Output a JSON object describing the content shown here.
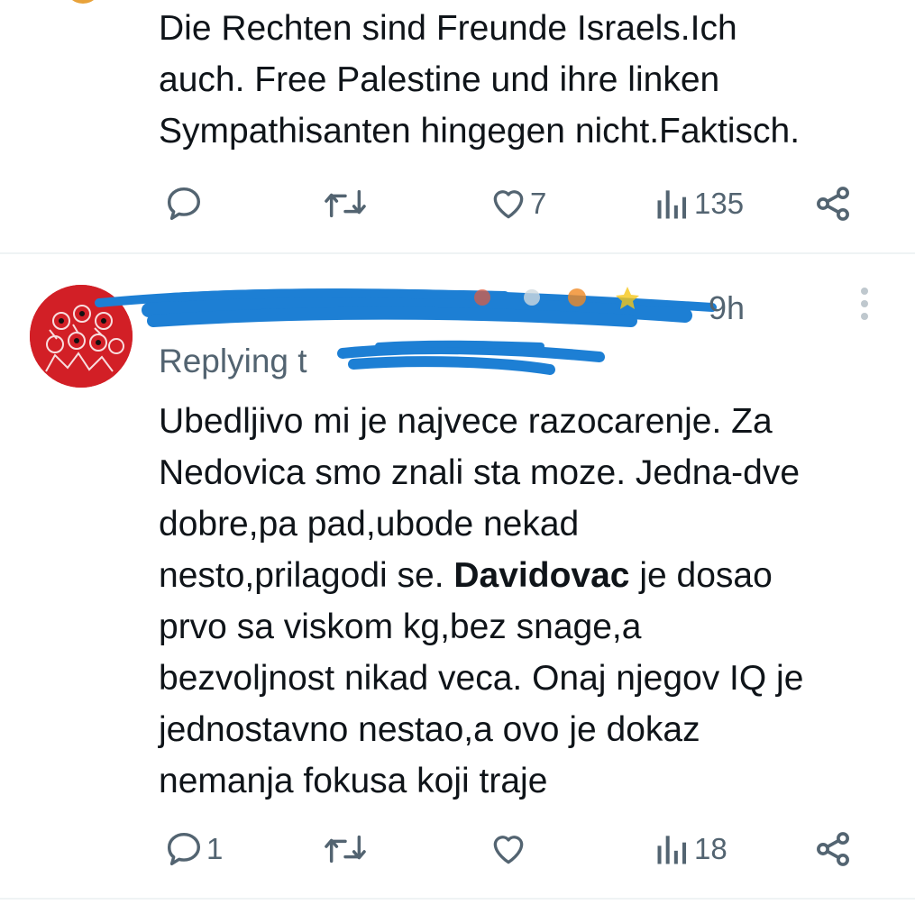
{
  "tweet1": {
    "text": "Die Rechten sind Freunde Israels.Ich\nauch. Free Palestine und ihre linken\nSympathisanten hingegen nicht.Faktisch.",
    "likes": "7",
    "views": "135"
  },
  "tweet2": {
    "time": "9h",
    "replying_prefix": "Replying t",
    "text_before": "Ubedljivo mi je najvece razocarenje. Za\nNedovica smo znali sta moze. Jedna-dve\ndobre,pa pad,ubode nekad\nnesto,prilagodi se. ",
    "mention": "Davidovac",
    "text_after": " je dosao\nprvo sa viskom kg,bez snage,a\nbezvoljnost nikad veca. Onaj njegov IQ je\njednostavno nestao,a ovo je dokaz\nnemanja fokusa koji traje",
    "replies": "1",
    "views": "18"
  },
  "icons": {
    "reply": "reply-icon",
    "retweet": "retweet-icon",
    "like": "heart-icon",
    "views": "views-icon",
    "share": "share-icon",
    "more": "more-vertical-icon"
  },
  "colors": {
    "text": "#0f1419",
    "muted": "#536471",
    "scribble": "#1d7fd4",
    "avatar": "#d21f26"
  }
}
